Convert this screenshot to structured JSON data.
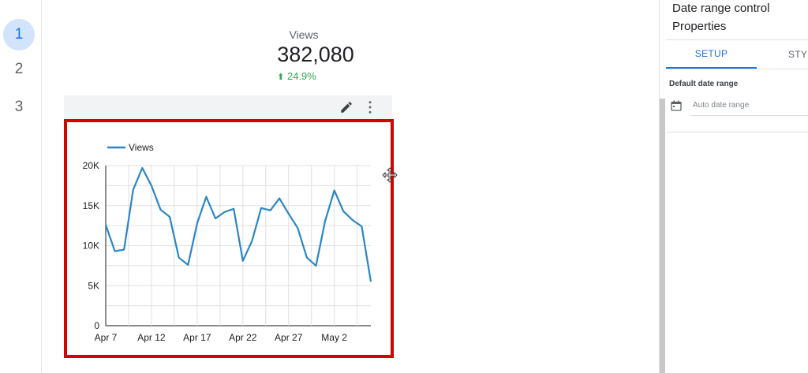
{
  "pages": [
    "1",
    "2",
    "3"
  ],
  "active_page": "1",
  "scorecard": {
    "label": "Views",
    "value": "382,080",
    "delta": "24.9%"
  },
  "colors": {
    "accent": "#1a73e8",
    "series": "#2a86c7",
    "highlight": "#d50000",
    "positive": "#34a853"
  },
  "icons": [
    "edit-icon",
    "more-vert-icon",
    "calendar-icon",
    "move-cursor-icon",
    "arrow-up-icon"
  ],
  "chart_data": {
    "type": "line",
    "legend": {
      "position": "top-left",
      "entries": [
        "Views"
      ]
    },
    "grid": true,
    "x_tick_labels": [
      "Apr 7",
      "Apr 12",
      "Apr 17",
      "Apr 22",
      "Apr 27",
      "May 2"
    ],
    "y_tick_labels": [
      "0",
      "5K",
      "10K",
      "15K",
      "20K"
    ],
    "ylim": [
      0,
      20000
    ],
    "x": [
      "Apr 7",
      "Apr 8",
      "Apr 9",
      "Apr 10",
      "Apr 11",
      "Apr 12",
      "Apr 13",
      "Apr 14",
      "Apr 15",
      "Apr 16",
      "Apr 17",
      "Apr 18",
      "Apr 19",
      "Apr 20",
      "Apr 21",
      "Apr 22",
      "Apr 23",
      "Apr 24",
      "Apr 25",
      "Apr 26",
      "Apr 27",
      "Apr 28",
      "Apr 29",
      "Apr 30",
      "May 1",
      "May 2",
      "May 3",
      "May 4",
      "May 5",
      "May 6"
    ],
    "series": [
      {
        "name": "Views",
        "values": [
          12600,
          9300,
          9500,
          17000,
          19700,
          17500,
          14500,
          13600,
          8500,
          7600,
          12800,
          16100,
          13400,
          14200,
          14600,
          8100,
          10600,
          14700,
          14400,
          15900,
          14000,
          12200,
          8500,
          7500,
          13100,
          16900,
          14300,
          13200,
          12400,
          5500
        ]
      }
    ]
  },
  "properties": {
    "title_line1": "Date range control",
    "title_line2": "Properties",
    "tabs": {
      "setup": "SETUP",
      "style": "STYL"
    },
    "section_label": "Default date range",
    "date_range_value": "Auto date range"
  }
}
